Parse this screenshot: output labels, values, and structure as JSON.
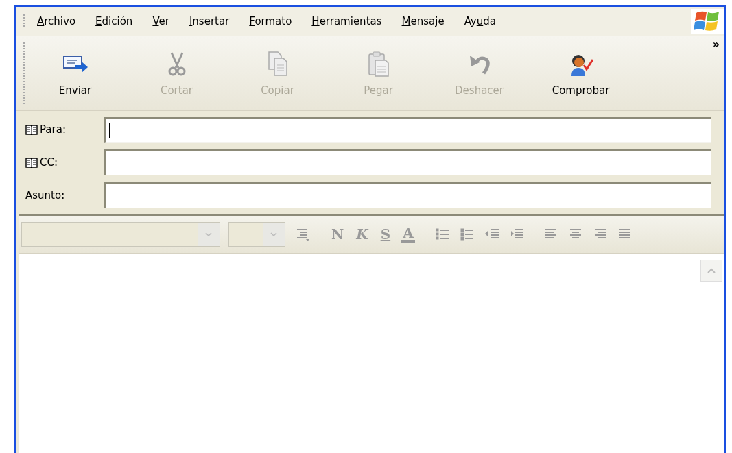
{
  "menu": [
    {
      "key": "A",
      "post": "rchivo"
    },
    {
      "key": "E",
      "post": "dición"
    },
    {
      "key": "V",
      "post": "er"
    },
    {
      "key": "I",
      "post": "nsertar"
    },
    {
      "key": "F",
      "post": "ormato"
    },
    {
      "key": "H",
      "post": "erramientas"
    },
    {
      "key": "M",
      "post": "ensaje"
    },
    {
      "pre": "Ay",
      "key": "u",
      "post": "da"
    }
  ],
  "toolbar": {
    "groups": [
      [
        {
          "label": "Enviar",
          "disabled": false
        }
      ],
      [
        {
          "label": "Cortar",
          "disabled": true
        },
        {
          "label": "Copiar",
          "disabled": true
        },
        {
          "label": "Pegar",
          "disabled": true
        },
        {
          "label": "Deshacer",
          "disabled": true
        }
      ],
      [
        {
          "label": "Comprobar",
          "disabled": false
        }
      ]
    ],
    "overflow": "»"
  },
  "fields": [
    {
      "label": "Para:",
      "address_book": true,
      "focused": true
    },
    {
      "label": "CC:",
      "address_book": true,
      "focused": false
    },
    {
      "label": "Asunto:",
      "address_book": false,
      "focused": false
    }
  ],
  "format_bar": [
    {
      "kind": "dropdown"
    },
    {
      "kind": "dropdown"
    },
    {
      "kind": "icon"
    },
    {
      "kind": "separator"
    },
    {
      "kind": "letter",
      "text": "N"
    },
    {
      "kind": "letter",
      "text": "K"
    },
    {
      "kind": "letter",
      "text": "S"
    },
    {
      "kind": "letter",
      "text": "A"
    },
    {
      "kind": "separator"
    },
    {
      "kind": "icon"
    },
    {
      "kind": "icon"
    },
    {
      "kind": "icon"
    },
    {
      "kind": "icon"
    },
    {
      "kind": "separator"
    },
    {
      "kind": "icon"
    },
    {
      "kind": "icon"
    },
    {
      "kind": "icon"
    },
    {
      "kind": "icon"
    }
  ]
}
